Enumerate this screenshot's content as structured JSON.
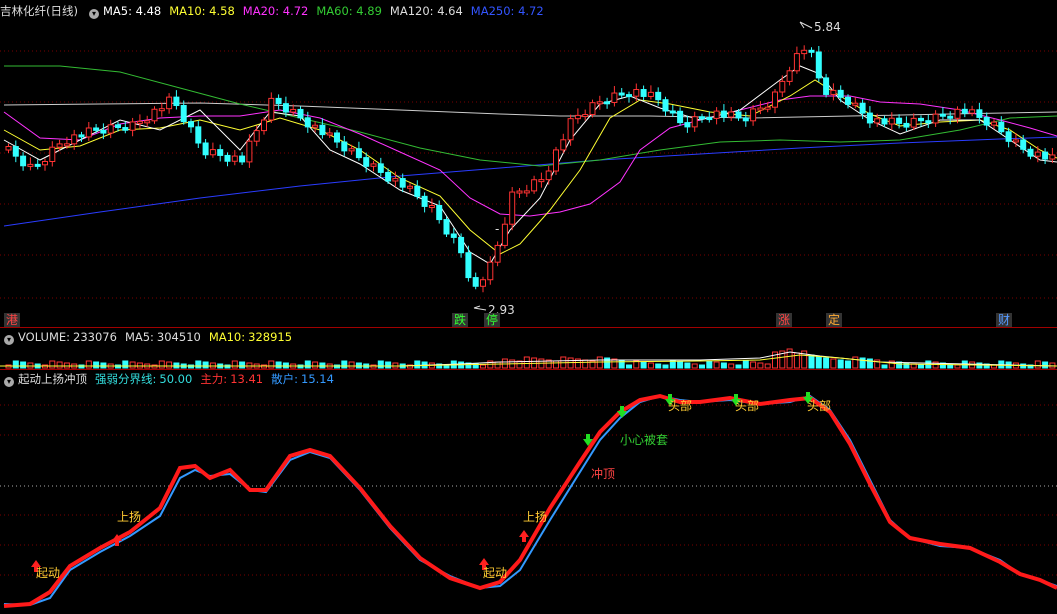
{
  "price_panel": {
    "stock_name": "吉林化纤",
    "period": "(日线)",
    "ma": [
      {
        "label": "MA5:",
        "value": "4.48",
        "color": "#ffffff"
      },
      {
        "label": "MA10:",
        "value": "4.58",
        "color": "#ffff33"
      },
      {
        "label": "MA20:",
        "value": "4.72",
        "color": "#ff33ff"
      },
      {
        "label": "MA60:",
        "value": "4.89",
        "color": "#33cc33"
      },
      {
        "label": "MA120:",
        "value": "4.64",
        "color": "#dddddd"
      },
      {
        "label": "MA250:",
        "value": "4.72",
        "color": "#3355ff"
      }
    ],
    "high_label": "5.84",
    "low_label": "2.93",
    "mid_mark": "-",
    "tags": [
      {
        "text": "港",
        "color": "#ff4444"
      },
      {
        "text": "跌",
        "color": "#33ff33"
      },
      {
        "text": "停",
        "color": "#33ff33"
      },
      {
        "text": "涨",
        "color": "#ff4444"
      },
      {
        "text": "定",
        "color": "#ffaa33"
      },
      {
        "text": "财",
        "color": "#5599ff"
      }
    ]
  },
  "volume_panel": {
    "label": "VOLUME:",
    "value": "233076",
    "ma5_label": "MA5:",
    "ma5": "304510",
    "ma10_label": "MA10:",
    "ma10": "328915"
  },
  "indicator_panel": {
    "name": "起动上扬冲顶",
    "threshold_label": "强弱分界线:",
    "threshold": "50.00",
    "main_label": "主力:",
    "main": "13.41",
    "retail_label": "散户:",
    "retail": "15.14",
    "annotations": [
      {
        "text": "起动",
        "color": "#ffcc33"
      },
      {
        "text": "上扬",
        "color": "#ffcc33"
      },
      {
        "text": "起动",
        "color": "#ffcc33"
      },
      {
        "text": "上扬",
        "color": "#ffcc33"
      },
      {
        "text": "冲顶",
        "color": "#ff4444"
      },
      {
        "text": "小心被套",
        "color": "#33cc33"
      },
      {
        "text": "头部",
        "color": "#ffcc33"
      },
      {
        "text": "头部",
        "color": "#ffcc33"
      },
      {
        "text": "头部",
        "color": "#ffcc33"
      }
    ]
  },
  "colors": {
    "up": "#ff3333",
    "down": "#33ffff",
    "grid": "#8b0000",
    "main_line": "#ff2020",
    "retail_line": "#3399ff"
  }
}
